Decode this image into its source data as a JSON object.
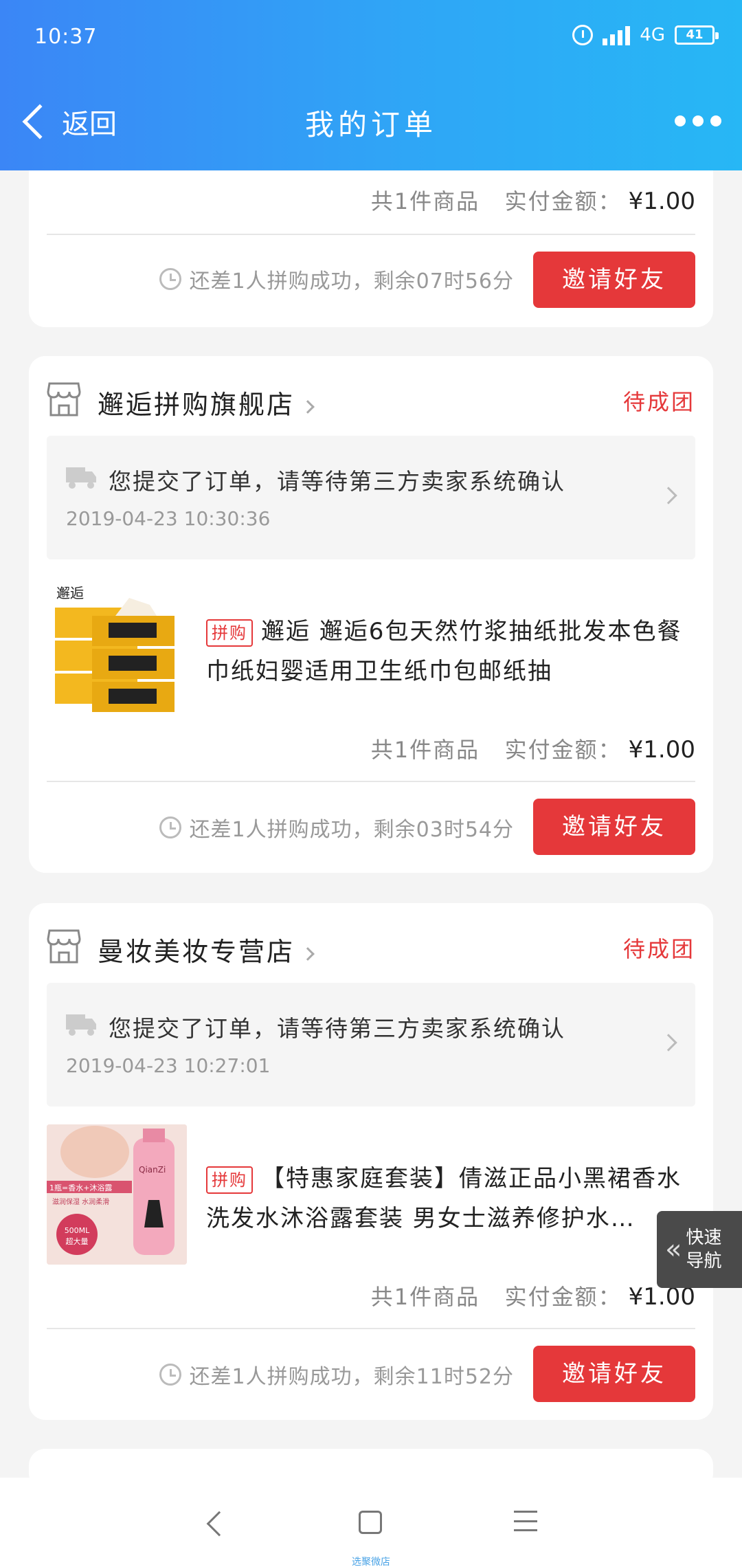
{
  "status_bar": {
    "time": "10:37",
    "network": "4G",
    "battery": "41"
  },
  "nav": {
    "back_label": "返回",
    "title": "我的订单"
  },
  "partial_card": {
    "summary_prefix": "共1件商品",
    "summary_amount_label": "实付金额：",
    "price": "¥1.00",
    "countdown": "还差1人拼购成功，剩余07时56分",
    "invite_label": "邀请好友"
  },
  "orders": [
    {
      "store": "邂逅拼购旗舰店",
      "status": "待成团",
      "notice": "您提交了订单，请等待第三方卖家系统确认",
      "time": "2019-04-23 10:30:36",
      "tag": "拼购",
      "product_title": "邂逅 邂逅6包天然竹浆抽纸批发本色餐巾纸妇婴适用卫生纸巾包邮纸抽",
      "summary_prefix": "共1件商品",
      "summary_amount_label": "实付金额：",
      "price": "¥1.00",
      "countdown": "还差1人拼购成功，剩余03时54分",
      "invite_label": "邀请好友",
      "image_brand": "邂逅"
    },
    {
      "store": "曼妆美妆专营店",
      "status": "待成团",
      "notice": "您提交了订单，请等待第三方卖家系统确认",
      "time": "2019-04-23 10:27:01",
      "tag": "拼购",
      "product_title": "【特惠家庭套装】倩滋正品小黑裙香水洗发水沐浴露套装 男女士滋养修护水…",
      "summary_prefix": "共1件商品",
      "summary_amount_label": "实付金额：",
      "price": "¥1.00",
      "countdown": "还差1人拼购成功，剩余11时52分",
      "invite_label": "邀请好友",
      "image_text_1": "1瓶=香水+沐浴露",
      "image_text_2": "滋润保湿 水润柔滑",
      "image_badge": "500ML",
      "image_badge_sub": "超大量",
      "image_brand": "QianZi"
    }
  ],
  "quick_nav": {
    "label_1": "快速",
    "label_2": "导航"
  },
  "watermark": "选聚微店",
  "colors": {
    "primary_red": "#e5383a",
    "header_start": "#3b86f6",
    "header_end": "#27b7f5"
  }
}
